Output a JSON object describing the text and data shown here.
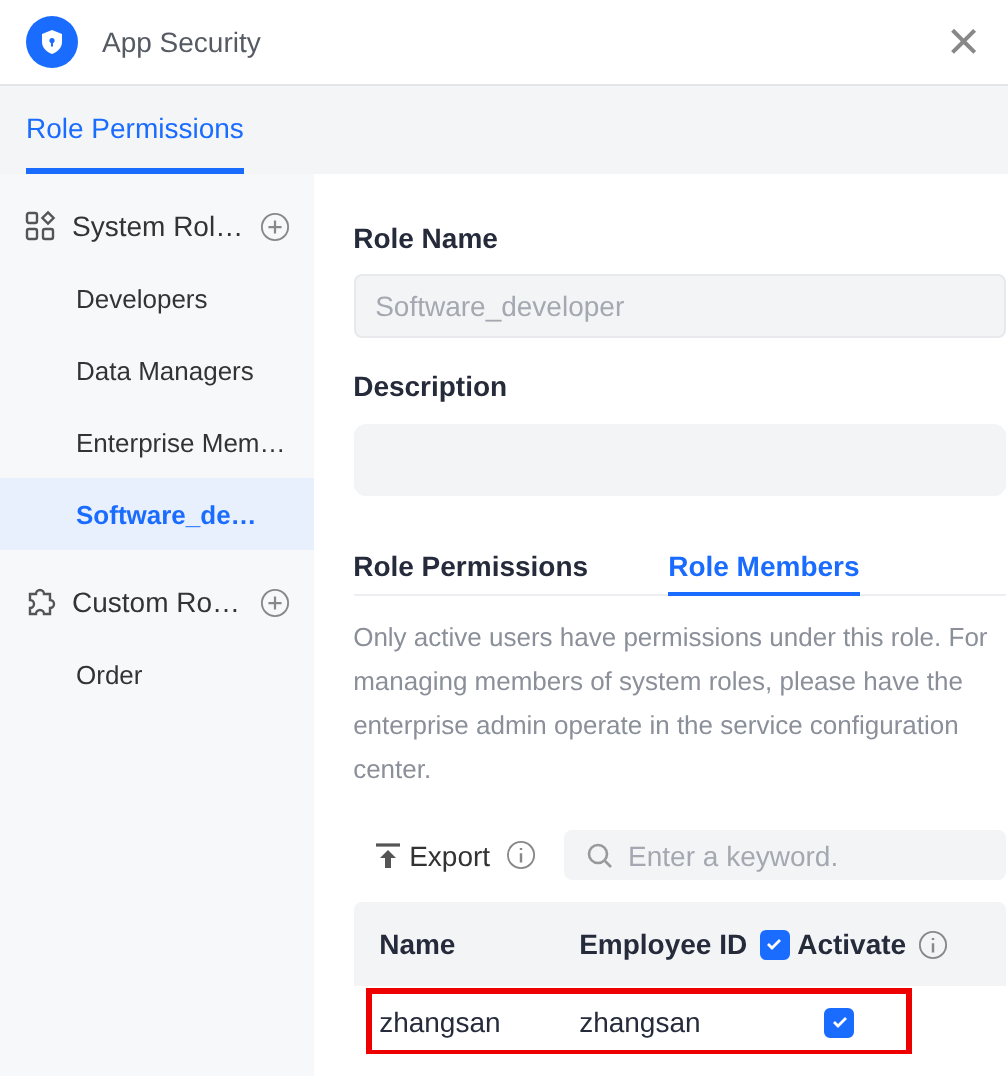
{
  "window": {
    "title": "App Security",
    "close": "×"
  },
  "top_tabs": [
    {
      "label": "Role Permissions",
      "selected": true
    }
  ],
  "sidebar": {
    "groups": [
      {
        "label": "System Rol…",
        "kind": "system",
        "items": [
          {
            "label": "Developers",
            "selected": false
          },
          {
            "label": "Data Managers",
            "selected": false
          },
          {
            "label": "Enterprise Mem…",
            "selected": false
          },
          {
            "label": "Software_de…",
            "selected": true
          }
        ]
      },
      {
        "label": "Custom Ro…",
        "kind": "custom",
        "items": [
          {
            "label": "Order",
            "selected": false
          }
        ]
      }
    ]
  },
  "form": {
    "role_name": {
      "label": "Role Name",
      "value": "Software_developer",
      "disabled": true
    },
    "description": {
      "label": "Description"
    }
  },
  "tabs": [
    {
      "label": "Role Permissions",
      "selected": false
    },
    {
      "label": "Role Members",
      "selected": true
    }
  ],
  "notice": "Only active users have permissions under this role. For managing members of system roles, please have the enterprise admin operate in the service configuration center.",
  "toolbar": {
    "export": "Export",
    "search": {
      "placeholder": "Enter a keyword."
    }
  },
  "table": {
    "columns": [
      "Name",
      "Employee ID",
      "Activate"
    ],
    "header_checked": true,
    "rows": [
      {
        "name": "zhangsan",
        "employee_id": "zhangsan",
        "active": true,
        "highlighted": true
      }
    ]
  }
}
